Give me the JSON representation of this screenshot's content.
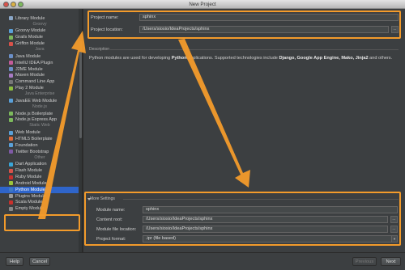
{
  "window": {
    "title": "New Project"
  },
  "sidebar": {
    "rows": [
      {
        "kind": "item",
        "label": "Library Module",
        "icon": "library-module-icon",
        "color": "#8aa7c8"
      },
      {
        "kind": "group",
        "label": "Groovy"
      },
      {
        "kind": "item",
        "label": "Groovy Module",
        "icon": "groovy-icon",
        "color": "#5aa0d8"
      },
      {
        "kind": "item",
        "label": "Grails Module",
        "icon": "grails-icon",
        "color": "#7cb95c"
      },
      {
        "kind": "item",
        "label": "Griffon Module",
        "icon": "griffon-icon",
        "color": "#d8524a"
      },
      {
        "kind": "group",
        "label": "Java"
      },
      {
        "kind": "item",
        "label": "Java Module",
        "icon": "java-module-icon",
        "color": "#6b8fc7"
      },
      {
        "kind": "item",
        "label": "IntelliJ IDEA Plugin",
        "icon": "intellij-plugin-icon",
        "color": "#c45b9a"
      },
      {
        "kind": "item",
        "label": "J2ME Module",
        "icon": "j2me-icon",
        "color": "#6b8fc7"
      },
      {
        "kind": "item",
        "label": "Maven Module",
        "icon": "maven-icon",
        "color": "#a87bc4"
      },
      {
        "kind": "item",
        "label": "Command Line App",
        "icon": "command-line-icon",
        "color": "#777"
      },
      {
        "kind": "item",
        "label": "Play 2 Module",
        "icon": "play-icon",
        "color": "#8cbf3f"
      },
      {
        "kind": "group",
        "label": "Java Enterprise"
      },
      {
        "kind": "item",
        "label": "JavaEE Web Module",
        "icon": "javaee-icon",
        "color": "#5aa0d8"
      },
      {
        "kind": "group",
        "label": "Node.js"
      },
      {
        "kind": "item",
        "label": "Node.js Boilerplate",
        "icon": "nodejs-icon",
        "color": "#7cb95c"
      },
      {
        "kind": "item",
        "label": "Node.js Express App",
        "icon": "express-icon",
        "color": "#7cb95c"
      },
      {
        "kind": "group",
        "label": "Static Web"
      },
      {
        "kind": "item",
        "label": "Web Module",
        "icon": "web-module-icon",
        "color": "#5aa0d8"
      },
      {
        "kind": "item",
        "label": "HTML5 Boilerplate",
        "icon": "html5-icon",
        "color": "#e06b3b"
      },
      {
        "kind": "item",
        "label": "Foundation",
        "icon": "foundation-icon",
        "color": "#5aa0d8"
      },
      {
        "kind": "item",
        "label": "Twitter Bootstrap",
        "icon": "bootstrap-icon",
        "color": "#7f5aa6"
      },
      {
        "kind": "group",
        "label": "Other"
      },
      {
        "kind": "item",
        "label": "Dart Application",
        "icon": "dart-icon",
        "color": "#39a6d8"
      },
      {
        "kind": "item",
        "label": "Flash Module",
        "icon": "flash-icon",
        "color": "#d8524a"
      },
      {
        "kind": "item",
        "label": "Ruby Module",
        "icon": "ruby-icon",
        "color": "#c9302c"
      },
      {
        "kind": "item",
        "label": "Android Module",
        "icon": "android-icon",
        "color": "#9bc43a"
      },
      {
        "kind": "item",
        "label": "Python Module",
        "icon": "python-icon",
        "color": "#3f7ac4",
        "selected": true
      },
      {
        "kind": "item",
        "label": "Plugins Module",
        "icon": "plugins-icon",
        "color": "#999"
      },
      {
        "kind": "item",
        "label": "Scala Module",
        "icon": "scala-icon",
        "color": "#c9302c"
      },
      {
        "kind": "item",
        "label": "Empty Module",
        "icon": "empty-module-icon",
        "color": "#888"
      }
    ]
  },
  "form": {
    "project_name_label": "Project name:",
    "project_name_value": "sphinx",
    "project_location_label": "Project location:",
    "project_location_value": "/Users/siosio/IdeaProjects/sphinx",
    "browse_label": "..."
  },
  "description": {
    "header": "Description",
    "text_1": "Python modules are used for developing ",
    "text_bold_1": "Python",
    "text_2": " applications. Supported technologies include ",
    "text_bold_2": "Django, Google App Engine, Mako, Jinja2",
    "text_3": " and others."
  },
  "more_settings": {
    "header": "More Settings",
    "module_name_label": "Module name:",
    "module_name_value": "sphinx",
    "content_root_label": "Content root:",
    "content_root_value": "/Users/siosio/IdeaProjects/sphinx",
    "module_file_label": "Module file location:",
    "module_file_value": "/Users/siosio/IdeaProjects/sphinx",
    "project_format_label": "Project format:",
    "project_format_value": ".ipr (file based)"
  },
  "buttons": {
    "help": "Help",
    "cancel": "Cancel",
    "previous": "Previous",
    "next": "Next"
  },
  "colors": {
    "annotation": "#f39b2b",
    "selection": "#2f65ca"
  }
}
